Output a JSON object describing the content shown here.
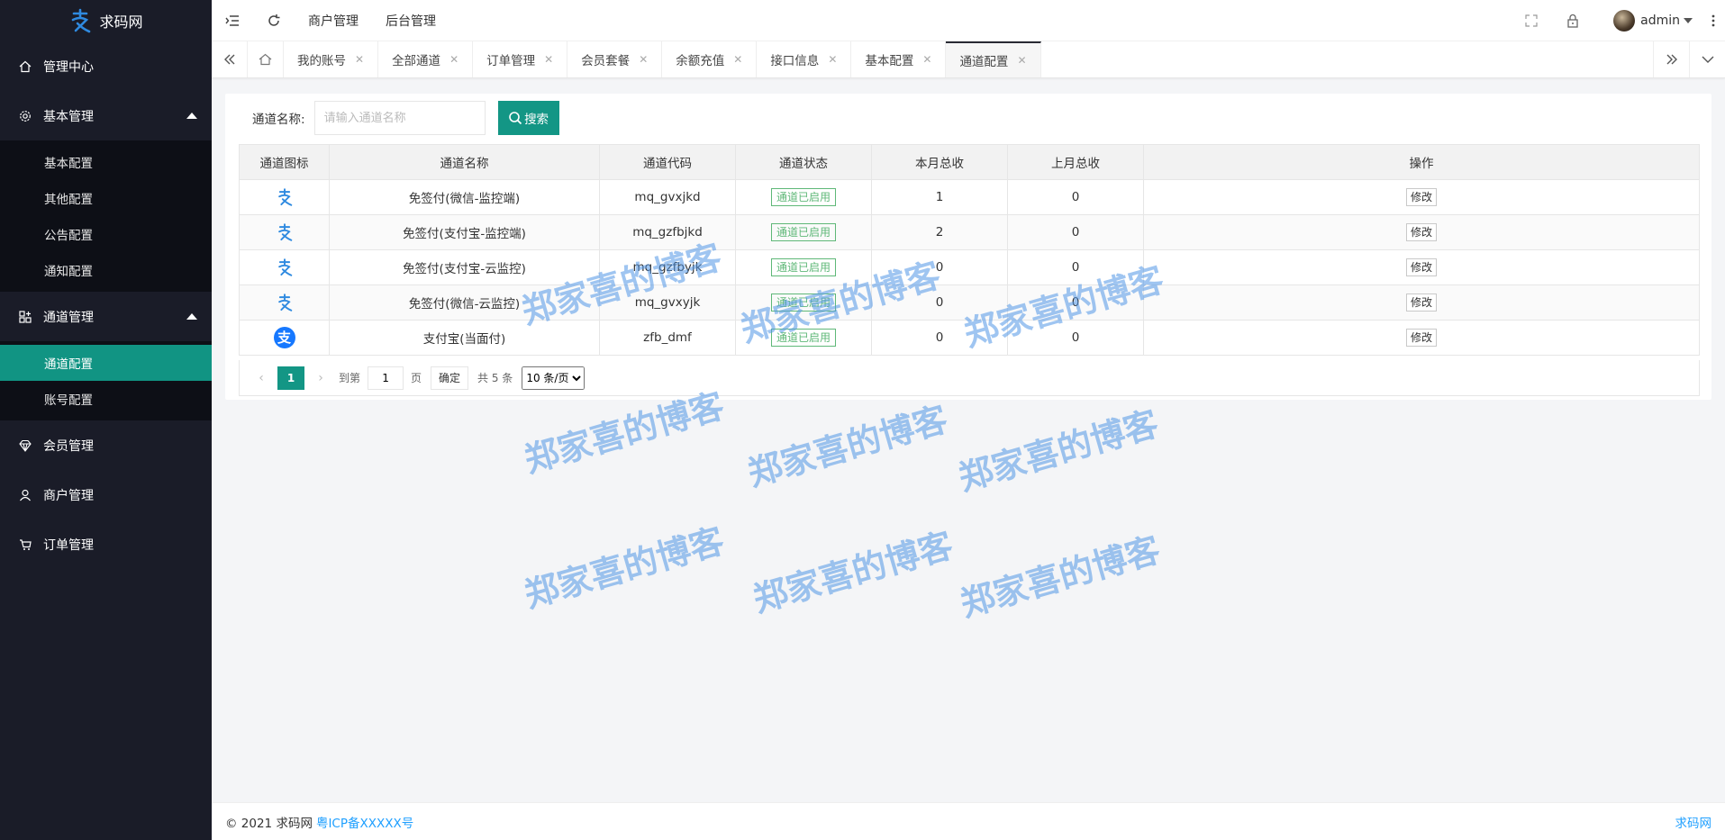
{
  "app": {
    "name": "求码网"
  },
  "sidebar": {
    "items": [
      {
        "label": "管理中心",
        "icon": "home-icon"
      },
      {
        "label": "基本管理",
        "icon": "gear-icon",
        "children": [
          "基本配置",
          "其他配置",
          "公告配置",
          "通知配置"
        ]
      },
      {
        "label": "通道管理",
        "icon": "apps-icon",
        "children": [
          "通道配置",
          "账号配置"
        ],
        "active_child": "通道配置"
      },
      {
        "label": "会员管理",
        "icon": "diamond-icon"
      },
      {
        "label": "商户管理",
        "icon": "user-icon"
      },
      {
        "label": "订单管理",
        "icon": "cart-icon"
      }
    ]
  },
  "header": {
    "links": [
      "商户管理",
      "后台管理"
    ],
    "user": "admin"
  },
  "tabs": [
    "我的账号",
    "全部通道",
    "订单管理",
    "会员套餐",
    "余额充值",
    "接口信息",
    "基本配置",
    "通道配置"
  ],
  "active_tab": "通道配置",
  "search": {
    "label": "通道名称:",
    "placeholder": "请输入通道名称",
    "button": "搜索"
  },
  "table": {
    "headers": [
      "通道图标",
      "通道名称",
      "通道代码",
      "通道状态",
      "本月总收",
      "上月总收",
      "操作"
    ],
    "rows": [
      {
        "icon": "qiuma-logo-icon",
        "name": "免签付(微信-监控端)",
        "code": "mq_gvxjkd",
        "status": "通道已启用",
        "this_month": "1",
        "last_month": "0",
        "action": "修改"
      },
      {
        "icon": "qiuma-logo-icon",
        "name": "免签付(支付宝-监控端)",
        "code": "mq_gzfbjkd",
        "status": "通道已启用",
        "this_month": "2",
        "last_month": "0",
        "action": "修改"
      },
      {
        "icon": "qiuma-logo-icon",
        "name": "免签付(支付宝-云监控)",
        "code": "mq_gzfbyjk",
        "status": "通道已启用",
        "this_month": "0",
        "last_month": "0",
        "action": "修改"
      },
      {
        "icon": "qiuma-logo-icon",
        "name": "免签付(微信-云监控)",
        "code": "mq_gvxyjk",
        "status": "通道已启用",
        "this_month": "0",
        "last_month": "0",
        "action": "修改"
      },
      {
        "icon": "alipay-icon",
        "name": "支付宝(当面付)",
        "code": "zfb_dmf",
        "status": "通道已启用",
        "this_month": "0",
        "last_month": "0",
        "action": "修改"
      }
    ]
  },
  "pager": {
    "current": "1",
    "goto_label": "到第",
    "goto_value": "1",
    "page_unit": "页",
    "ok": "确定",
    "total": "共 5 条",
    "page_size": "10 条/页"
  },
  "footer": {
    "copyright": "© 2021 求码网",
    "icp": "粤ICP备XXXXX号",
    "right": "求码网"
  },
  "watermark": "郑家喜的博客",
  "colors": {
    "sidebar": "#1a1c28",
    "accent": "#139685",
    "status": "#5fb878",
    "link": "#1e9fff"
  }
}
